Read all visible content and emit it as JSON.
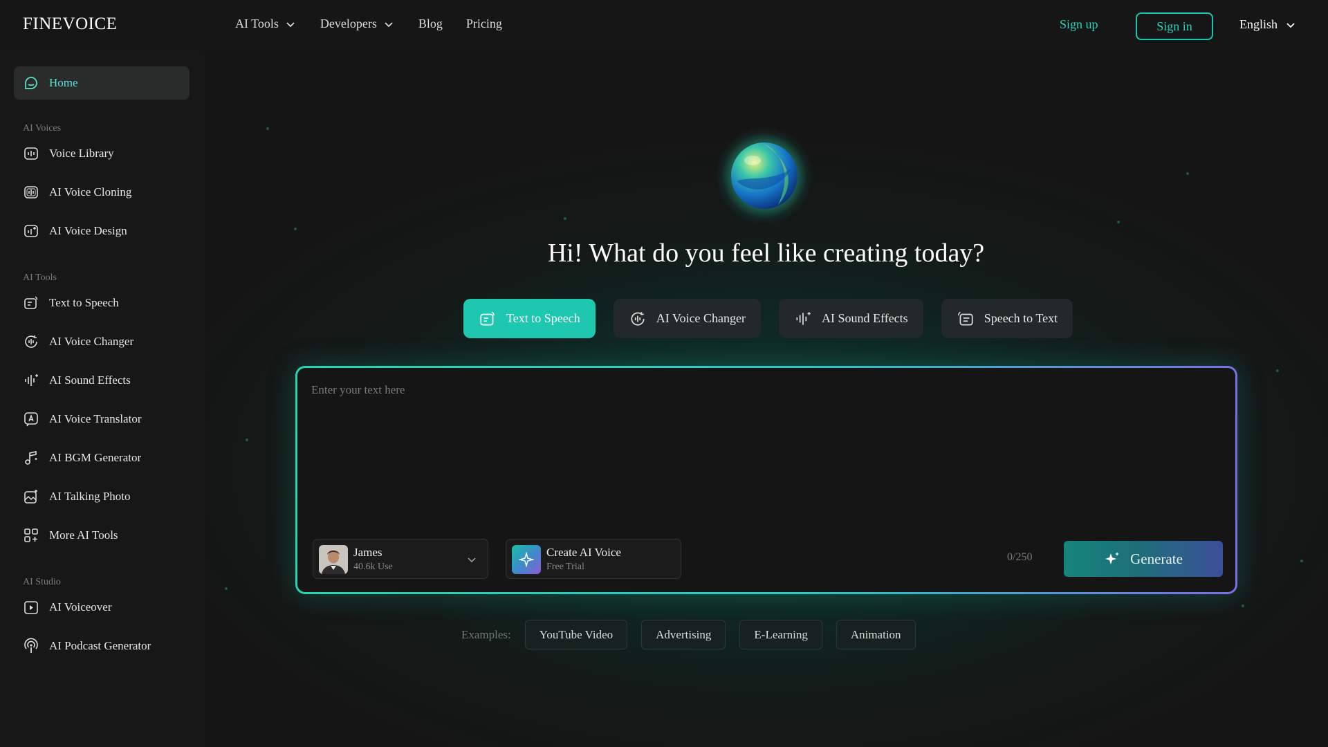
{
  "brand": {
    "logo_text": "FINEVOICE",
    "accent": "#1ec7b0"
  },
  "topnav": {
    "links": [
      {
        "label": "AI Tools",
        "has_dropdown": true
      },
      {
        "label": "Developers",
        "has_dropdown": true
      },
      {
        "label": "Blog",
        "has_dropdown": false
      },
      {
        "label": "Pricing",
        "has_dropdown": false
      }
    ],
    "signup_label": "Sign up",
    "signin_label": "Sign in",
    "language": "English"
  },
  "sidebar": {
    "home": {
      "label": "Home",
      "icon": "home-chat-icon"
    },
    "sections": [
      {
        "title": "AI Voices",
        "items": [
          {
            "label": "Voice Library",
            "icon": "voice-library-icon"
          },
          {
            "label": "AI Voice Cloning",
            "icon": "voice-cloning-icon"
          },
          {
            "label": "AI Voice Design",
            "icon": "voice-design-icon"
          }
        ]
      },
      {
        "title": "AI Tools",
        "items": [
          {
            "label": "Text to Speech",
            "icon": "text-to-speech-icon"
          },
          {
            "label": "AI Voice Changer",
            "icon": "voice-changer-icon"
          },
          {
            "label": "AI Sound Effects",
            "icon": "sound-effects-icon"
          },
          {
            "label": "AI Voice Translator",
            "icon": "translator-icon"
          },
          {
            "label": "AI BGM Generator",
            "icon": "music-note-icon"
          },
          {
            "label": "AI Talking Photo",
            "icon": "talking-photo-icon"
          },
          {
            "label": "More AI Tools",
            "icon": "grid-icon"
          }
        ]
      },
      {
        "title": "AI Studio",
        "items": [
          {
            "label": "AI Voiceover",
            "icon": "voiceover-play-icon"
          },
          {
            "label": "AI Podcast Generator",
            "icon": "podcast-icon"
          }
        ]
      }
    ]
  },
  "main": {
    "headline": "Hi! What do you feel like creating today?",
    "tabs": [
      {
        "label": "Text to Speech",
        "icon": "text-to-speech-icon",
        "active": true
      },
      {
        "label": "AI Voice Changer",
        "icon": "voice-changer-icon",
        "active": false
      },
      {
        "label": "AI Sound Effects",
        "icon": "sound-effects-icon",
        "active": false
      },
      {
        "label": "Speech to Text",
        "icon": "speech-to-text-icon",
        "active": false
      }
    ],
    "editor": {
      "placeholder": "Enter your text here",
      "value": "",
      "voice": {
        "name": "James",
        "usage": "40.6k Use"
      },
      "create_voice": {
        "title": "Create AI Voice",
        "subtitle": "Free Trial"
      },
      "char_count": "0/250",
      "generate_label": "Generate"
    },
    "examples": {
      "label": "Examples:",
      "chips": [
        "YouTube Video",
        "Advertising",
        "E-Learning",
        "Animation"
      ]
    }
  }
}
